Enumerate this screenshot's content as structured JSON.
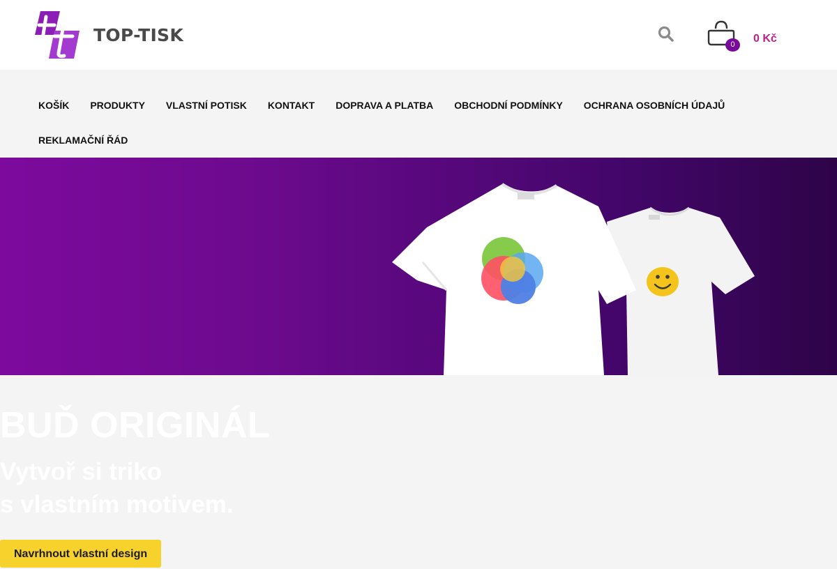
{
  "header": {
    "brand": "TOP-TISK",
    "cart_count": "0",
    "cart_total": "0 Kč"
  },
  "nav": {
    "row1": [
      "KOŠÍK",
      "PRODUKTY",
      "VLASTNÍ POTISK",
      "KONTAKT",
      "DOPRAVA A PLATBA",
      "OBCHODNÍ PODMÍNKY",
      "OCHRANA OSOBNÍCH ÚDAJŮ"
    ],
    "row2": [
      "REKLAMAČNÍ ŘÁD"
    ]
  },
  "hero": {
    "title": "BUĎ ORIGINÁL",
    "subtitle_line1": "Vytvoř si triko",
    "subtitle_line2": "s vlastním motivem.",
    "cta": "Navrhnout vlastní design"
  },
  "colors": {
    "brand_purple": "#7a0a9b",
    "price_pink": "#c0208a",
    "cta_yellow": "#f7d22c"
  },
  "icons": [
    "logo-mark-icon",
    "search-icon",
    "shopping-bag-icon",
    "tshirt-icon",
    "smiley-icon"
  ]
}
